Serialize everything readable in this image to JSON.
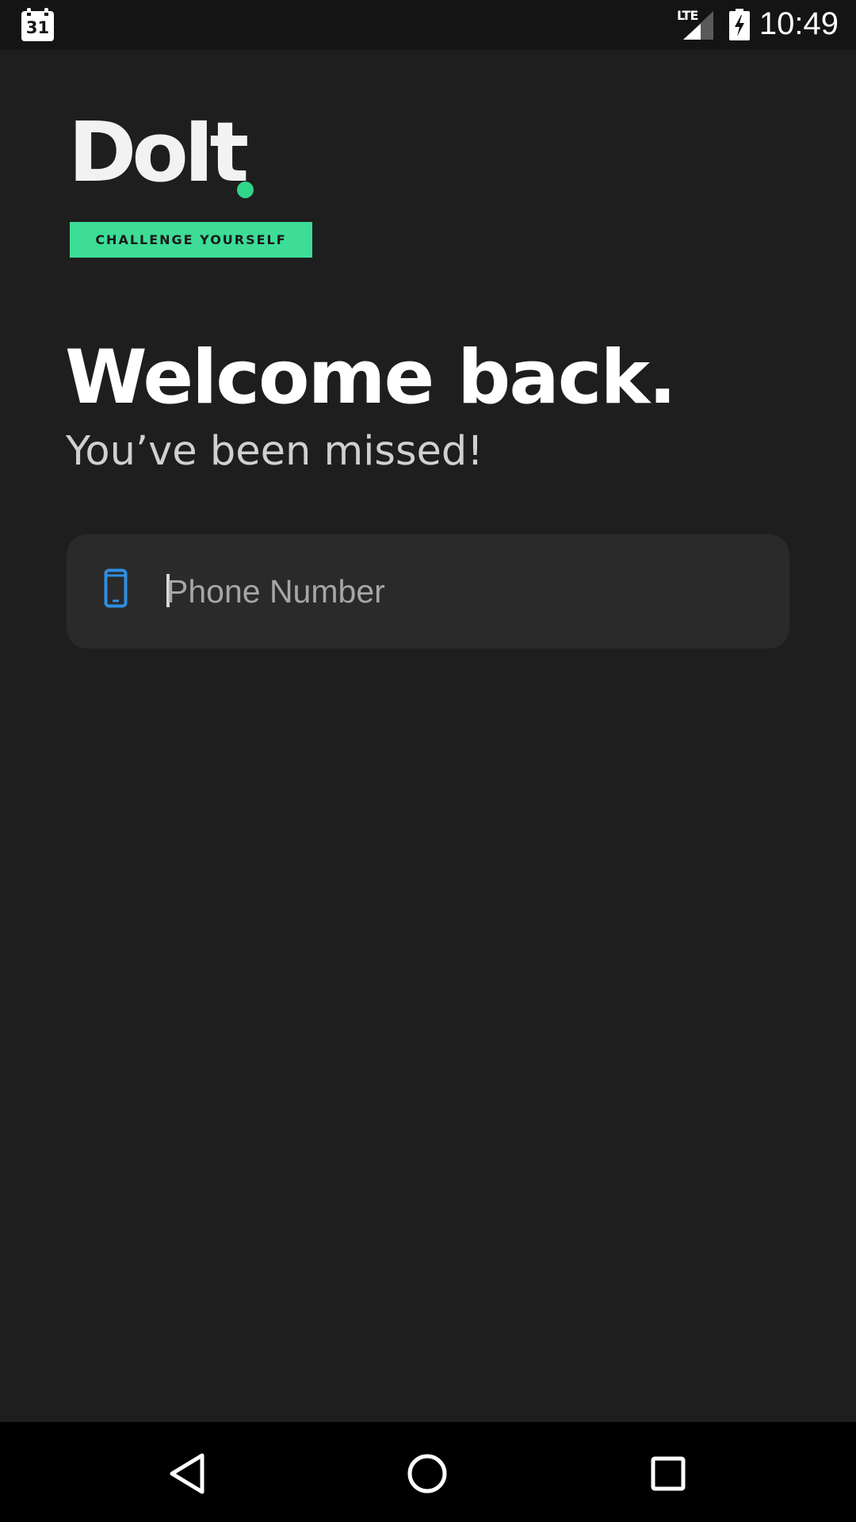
{
  "status_bar": {
    "calendar_day": "31",
    "network": "LTE",
    "time": "10:49",
    "icons": [
      "calendar-icon",
      "lte-signal-icon",
      "battery-charging-icon"
    ]
  },
  "brand": {
    "name": "DoIt",
    "tagline": "CHALLENGE YOURSELF",
    "accent_color": "#3ddc97"
  },
  "welcome": {
    "title": "Welcome back.",
    "subtitle": "You’ve been missed!"
  },
  "phone_field": {
    "placeholder": "Phone Number",
    "value": "",
    "icon": "smartphone-icon",
    "icon_color": "#2f8ee0"
  },
  "nav_bar": {
    "buttons": [
      "back-icon",
      "home-icon",
      "recents-icon"
    ]
  },
  "colors": {
    "background": "#1e1e1e",
    "status_bar": "#141414",
    "field_background": "#2a2a2a",
    "nav_bar": "#000000"
  }
}
